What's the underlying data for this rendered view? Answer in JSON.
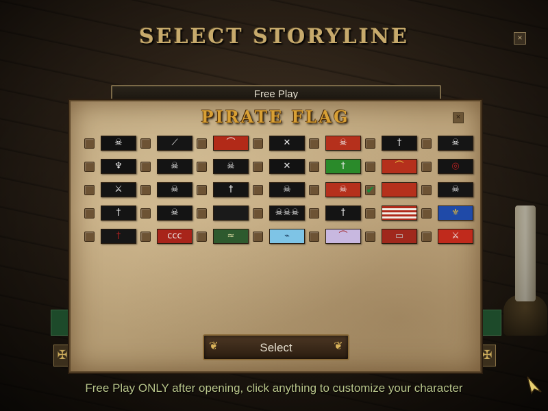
{
  "screen": {
    "title": "SELECT STORYLINE",
    "close_glyph": "×"
  },
  "storyline": {
    "label": "Free Play"
  },
  "dialog": {
    "title": "PIRATE FLAG",
    "close_glyph": "×",
    "select_label": "Select",
    "check_glyph": "✔"
  },
  "footer": {
    "hint": "Free Play ONLY after opening, click anything to customize your character"
  },
  "colors": {
    "title_gold": "#c7aa6c",
    "dialog_title": "#d8a035",
    "hint_text": "#b8c48a",
    "check_green": "#1c8a3a"
  },
  "flags": [
    {
      "icon": "skull-crossed-swords-icon",
      "bg": "#111111",
      "sym": "☠",
      "color": "#eeeeee",
      "checked": false
    },
    {
      "icon": "white-sword-icon",
      "bg": "#151515",
      "sym": "⟋",
      "color": "#eeeeee",
      "checked": false
    },
    {
      "icon": "white-sword-icon",
      "bg": "#b22a18",
      "sym": "⌒",
      "color": "#eeeeee",
      "checked": false
    },
    {
      "icon": "skeleton-icon",
      "bg": "#141414",
      "sym": "✕",
      "color": "#eeeeee",
      "checked": false
    },
    {
      "icon": "skull-crossbones-icon",
      "bg": "#b5301c",
      "sym": "☠",
      "color": "#eeeeee",
      "checked": false
    },
    {
      "icon": "skeleton-icon",
      "bg": "#131313",
      "sym": "†",
      "color": "#eeeeee",
      "checked": false
    },
    {
      "icon": "skull-crossbones-icon",
      "bg": "#151515",
      "sym": "☠",
      "color": "#eeeeee",
      "checked": false
    },
    {
      "icon": "skeleton-icon",
      "bg": "#121212",
      "sym": "♆",
      "color": "#eeeeee",
      "checked": false
    },
    {
      "icon": "skull-crossbones-icon",
      "bg": "#141414",
      "sym": "☠",
      "color": "#eeeeee",
      "checked": false
    },
    {
      "icon": "skull-icon",
      "bg": "#141414",
      "sym": "☠",
      "color": "#eeeeee",
      "checked": false
    },
    {
      "icon": "skulls-icon",
      "bg": "#121212",
      "sym": "✕",
      "color": "#eeeeee",
      "checked": false
    },
    {
      "icon": "skeleton-icon",
      "bg": "#2a8a2a",
      "sym": "†",
      "color": "#eeeeee",
      "checked": false
    },
    {
      "icon": "white-sword-icon",
      "bg": "#b5301c",
      "sym": "⌒",
      "color": "#e8c040",
      "checked": false
    },
    {
      "icon": "red-spiral-icon",
      "bg": "#141414",
      "sym": "◎",
      "color": "#b02020",
      "checked": false
    },
    {
      "icon": "skeleton-icon",
      "bg": "#141414",
      "sym": "⚔",
      "color": "#eeeeee",
      "checked": false
    },
    {
      "icon": "skull-crossbones-icon",
      "bg": "#131313",
      "sym": "☠",
      "color": "#eeeeee",
      "checked": false
    },
    {
      "icon": "skeleton-icon",
      "bg": "#141414",
      "sym": "†",
      "color": "#eeeeee",
      "checked": false
    },
    {
      "icon": "skull-crossbones-icon",
      "bg": "#141414",
      "sym": "☠",
      "color": "#eeeeee",
      "checked": false
    },
    {
      "icon": "skull-crossbones-icon",
      "bg": "#b5301c",
      "sym": "☠",
      "color": "#eeeeee",
      "checked": false
    },
    {
      "icon": "red-flag-icon",
      "bg": "#b5301c",
      "sym": "",
      "color": "#eeeeee",
      "checked": true
    },
    {
      "icon": "skull-icon",
      "bg": "#151515",
      "sym": "☠",
      "color": "#eeeeee",
      "checked": false
    },
    {
      "icon": "skeleton-icon",
      "bg": "#141414",
      "sym": "†",
      "color": "#eeeeee",
      "checked": false
    },
    {
      "icon": "skull-crossbones-icon",
      "bg": "#141414",
      "sym": "☠",
      "color": "#eeeeee",
      "checked": false
    },
    {
      "icon": "black-flag-icon",
      "bg": "#1a1a1a",
      "sym": "",
      "color": "#eeeeee",
      "checked": false
    },
    {
      "icon": "skulls-icon",
      "bg": "#141414",
      "sym": "☠☠☠",
      "color": "#eeeeee",
      "checked": false
    },
    {
      "icon": "skeleton-icon",
      "bg": "#141414",
      "sym": "†",
      "color": "#eeeeee",
      "checked": false
    },
    {
      "icon": "striped-flag-icon",
      "bg": "repeating-linear-gradient(180deg,#b02a1a 0px,#b02a1a 3px,#f2efe6 3px,#f2efe6 6px)",
      "sym": "",
      "color": "#eeeeee",
      "checked": false
    },
    {
      "icon": "fleur-de-lis-icon",
      "bg": "#1f4aa8",
      "sym": "⚜",
      "color": "#f0c030",
      "checked": false
    },
    {
      "icon": "red-figure-icon",
      "bg": "#161616",
      "sym": "†",
      "color": "#b02020",
      "checked": false
    },
    {
      "icon": "red-flag-icon",
      "bg": "#a8241a",
      "sym": "ccc",
      "color": "#eeeeee",
      "checked": false
    },
    {
      "icon": "green-flag-icon",
      "bg": "#2e5a2e",
      "sym": "≈",
      "color": "#d8d8a0",
      "checked": false
    },
    {
      "icon": "cyan-flag-icon",
      "bg": "#7ec4e6",
      "sym": "⌁",
      "color": "#1a3a5a",
      "checked": false
    },
    {
      "icon": "lavender-flag-icon",
      "bg": "#c8b8e0",
      "sym": "⌒",
      "color": "#a02020",
      "checked": false
    },
    {
      "icon": "red-crest-flag-icon",
      "bg": "#a0281c",
      "sym": "▭",
      "color": "#c0c0c0",
      "checked": false
    },
    {
      "icon": "red-crossed-swords-icon",
      "bg": "#c02a1c",
      "sym": "⚔",
      "color": "#eeeeee",
      "checked": false
    }
  ]
}
